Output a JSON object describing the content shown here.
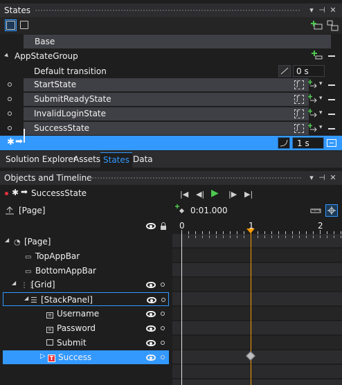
{
  "states_panel": {
    "title": "States",
    "pin": "⊣",
    "close": "✕",
    "dropdown": "▾",
    "base_label": "Base",
    "group_label": "AppStateGroup",
    "default_transition_label": "Default transition",
    "default_transition_value": "0 s",
    "states": [
      {
        "label": "StartState",
        "recording": false
      },
      {
        "label": "SubmitReadyState",
        "recording": false
      },
      {
        "label": "InvalidLoginState",
        "recording": false
      },
      {
        "label": "SuccessState",
        "recording": true
      }
    ],
    "transition_value": "1 s"
  },
  "tabs": [
    {
      "label": "Solution Explorer",
      "active": false
    },
    {
      "label": "Assets",
      "active": false
    },
    {
      "label": "States",
      "active": true
    },
    {
      "label": "Data",
      "active": false
    }
  ],
  "timeline_panel": {
    "title": "Objects and Timeline",
    "active_state": "SuccessState",
    "scope_label": "[Page]",
    "time_readout": "0:01.000",
    "ruler_ticks": [
      "0",
      "1",
      "2"
    ],
    "tree": [
      {
        "label": "[Page]",
        "level": 0
      },
      {
        "label": "TopAppBar",
        "level": 1
      },
      {
        "label": "BottomAppBar",
        "level": 1
      },
      {
        "label": "[Grid]",
        "level": 1
      },
      {
        "label": "[StackPanel]",
        "level": 2
      },
      {
        "label": "Username",
        "level": 3
      },
      {
        "label": "Password",
        "level": 3
      },
      {
        "label": "Submit",
        "level": 3
      },
      {
        "label": "Success",
        "level": 3
      }
    ]
  },
  "colors": {
    "accent": "#3399ff",
    "panel_bg": "#1e1e1e",
    "header_bg": "#2d2d30",
    "state_bar": "#3f3f46",
    "playhead": "#ff9d00",
    "record_red": "#e8323c",
    "play_green": "#4ec94e"
  }
}
